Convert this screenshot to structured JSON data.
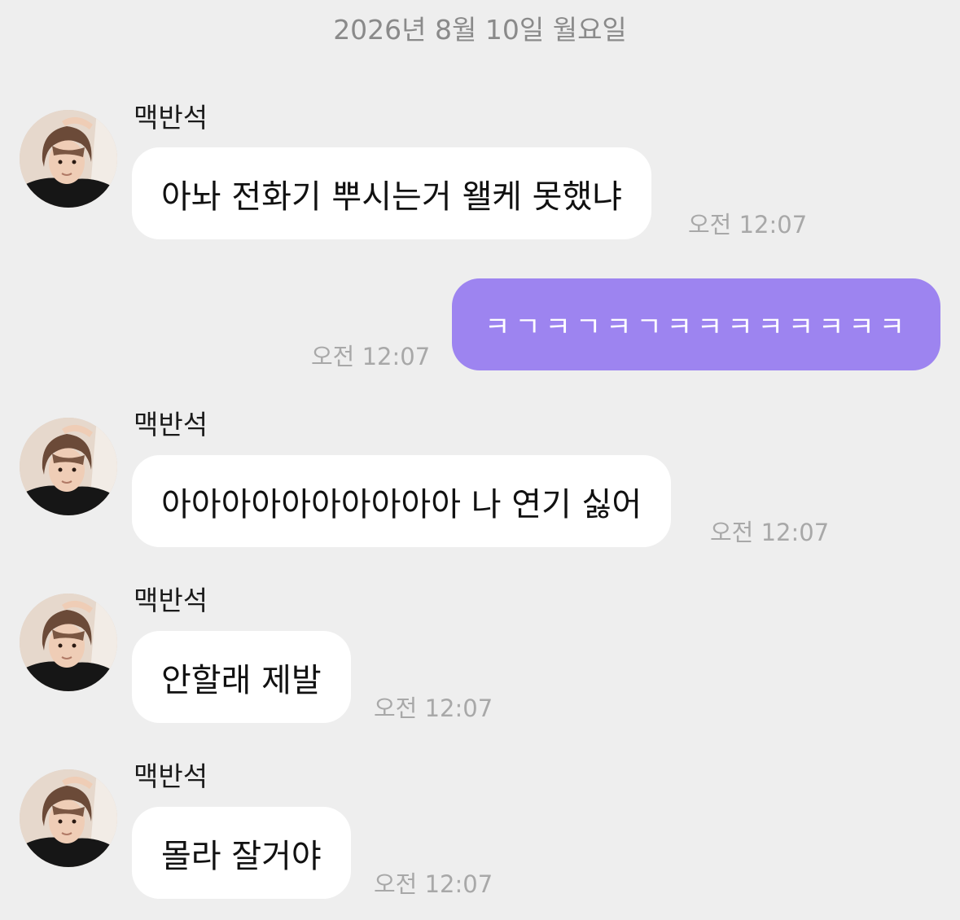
{
  "chat": {
    "date_header": "2026년 8월 10일 월요일",
    "messages": [
      {
        "direction": "incoming",
        "sender": "맥반석",
        "text": "아놔 전화기 뿌시는거 왤케 못했냐",
        "time": "오전 12:07"
      },
      {
        "direction": "outgoing",
        "text": "ㅋㄱㅋㄱㅋㄱㅋㅋㅋㅋㅋㅋㅋㅋ",
        "time": "오전 12:07"
      },
      {
        "direction": "incoming",
        "sender": "맥반석",
        "text": "아아아아아아아아아아 나 연기 싫어",
        "time": "오전 12:07"
      },
      {
        "direction": "incoming",
        "sender": "맥반석",
        "text": "안할래 제발",
        "time": "오전 12:07"
      },
      {
        "direction": "incoming",
        "sender": "맥반석",
        "text": "몰라 잘거야",
        "time": "오전 12:07"
      }
    ]
  },
  "colors": {
    "background": "#eeeeee",
    "incoming_bubble": "#ffffff",
    "outgoing_bubble": "#9d84f0",
    "timestamp": "#a8a8a8"
  },
  "icons": {
    "avatar": "profile-photo"
  }
}
